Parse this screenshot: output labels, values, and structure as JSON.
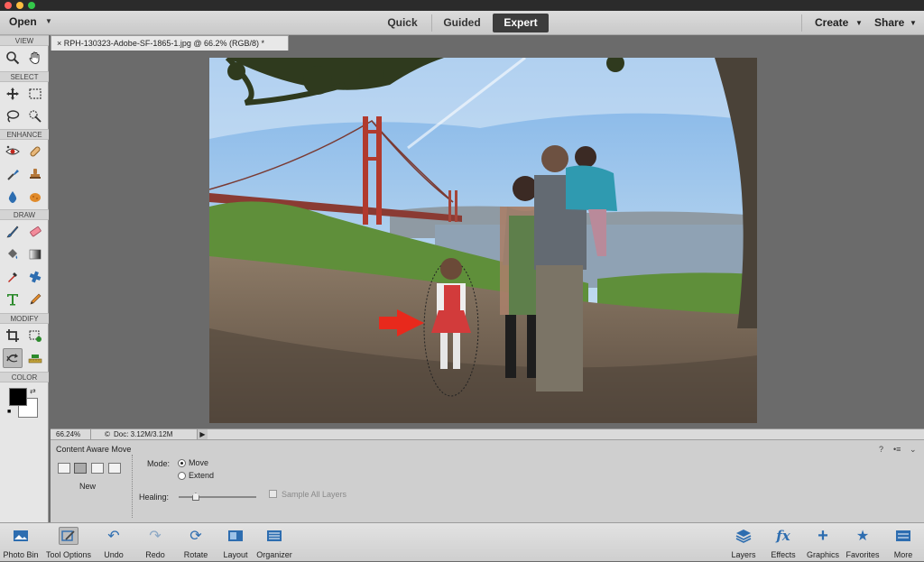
{
  "menubar": {
    "open_label": "Open",
    "modes": [
      "Quick",
      "Guided",
      "Expert"
    ],
    "active_mode": "Expert",
    "create_label": "Create",
    "share_label": "Share"
  },
  "toolbox": {
    "sections": [
      "VIEW",
      "SELECT",
      "ENHANCE",
      "DRAW",
      "MODIFY",
      "COLOR"
    ]
  },
  "document": {
    "tab_title": "RPH-130323-Adobe-SF-1865-1.jpg @ 66.2% (RGB/8) *"
  },
  "status": {
    "zoom": "66.24%",
    "doc_size": "Doc: 3.12M/3.12M"
  },
  "tool_options": {
    "title": "Content Aware Move",
    "new_label": "New",
    "mode_label": "Mode:",
    "mode_options": [
      "Move",
      "Extend"
    ],
    "mode_selected": "Move",
    "healing_label": "Healing:",
    "healing_level": 0.22,
    "sample_all_layers": "Sample All Layers",
    "sample_all_layers_checked": false
  },
  "bottom_bar": {
    "left": [
      "Photo Bin",
      "Tool Options",
      "Undo",
      "Redo",
      "Rotate",
      "Layout",
      "Organizer"
    ],
    "right": [
      "Layers",
      "Effects",
      "Graphics",
      "Favorites",
      "More"
    ],
    "active": "Tool Options"
  },
  "colors": {
    "accent": "#2d6db0",
    "active_mode_bg": "#3c3c3c",
    "arrow": "#e8291c"
  }
}
